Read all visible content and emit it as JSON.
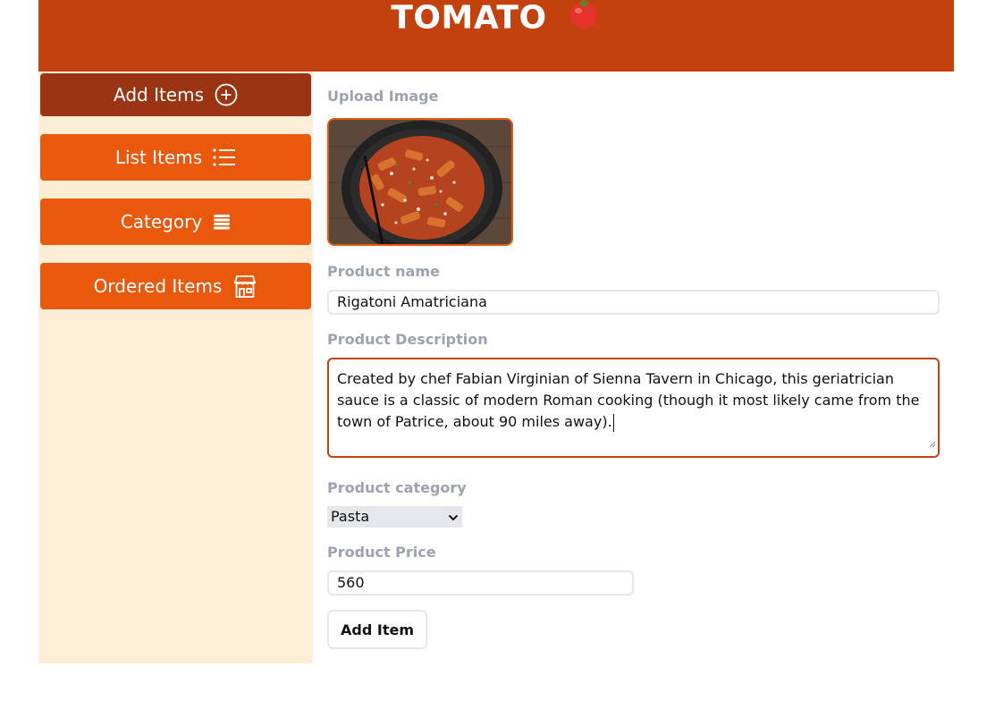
{
  "header": {
    "brand": "TOMATO"
  },
  "sidebar": {
    "items": [
      {
        "label": "Add Items",
        "icon": "plus-circle-icon"
      },
      {
        "label": "List Items",
        "icon": "list-icon"
      },
      {
        "label": "Category",
        "icon": "layers-icon"
      },
      {
        "label": "Ordered Items",
        "icon": "store-icon"
      }
    ]
  },
  "form": {
    "upload_label": "Upload Image",
    "name_label": "Product name",
    "name_value": "Rigatoni Amatriciana",
    "description_label": "Product Description",
    "description_value": "Created by chef Fabian Virginian of Sienna Tavern in Chicago, this geriatrician sauce is a classic of modern Roman cooking (though it most likely came from the town of Patrice, about 90 miles away).",
    "category_label": "Product category",
    "category_value": "Pasta",
    "price_label": "Product Price",
    "price_value": "560",
    "submit_label": "Add Item"
  },
  "colors": {
    "header": "#c2410c",
    "nav_button": "#ea580c",
    "nav_active": "#9a3412",
    "sidebar_bg": "#ffedd5"
  }
}
